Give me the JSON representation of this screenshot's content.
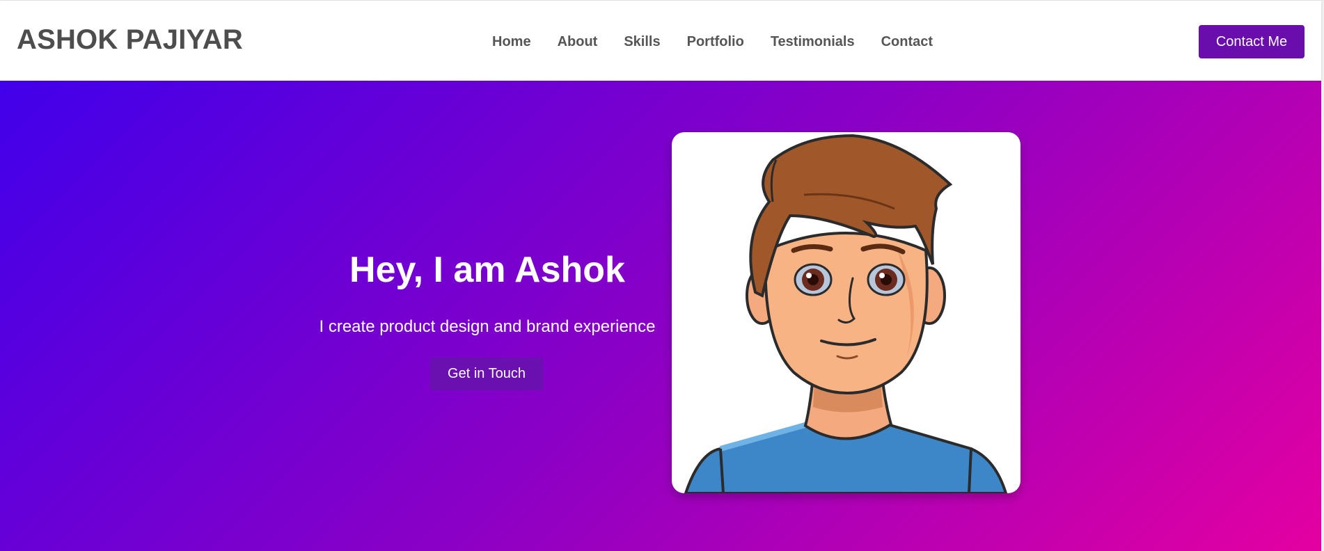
{
  "header": {
    "brand": "ASHOK PAJIYAR",
    "nav": [
      {
        "label": "Home"
      },
      {
        "label": "About"
      },
      {
        "label": "Skills"
      },
      {
        "label": "Portfolio"
      },
      {
        "label": "Testimonials"
      },
      {
        "label": "Contact"
      }
    ],
    "contact_button": "Contact Me"
  },
  "hero": {
    "title": "Hey, I am Ashok",
    "subtitle": "I create product design and brand experience",
    "cta_label": "Get in Touch",
    "avatar_icon": "cartoon-avatar-icon"
  },
  "colors": {
    "accent": "#6a0dad",
    "gradient_start": "#4100ea",
    "gradient_mid": "#8a00c6",
    "gradient_end": "#e400a1",
    "brand_text": "#4d4d4d"
  }
}
